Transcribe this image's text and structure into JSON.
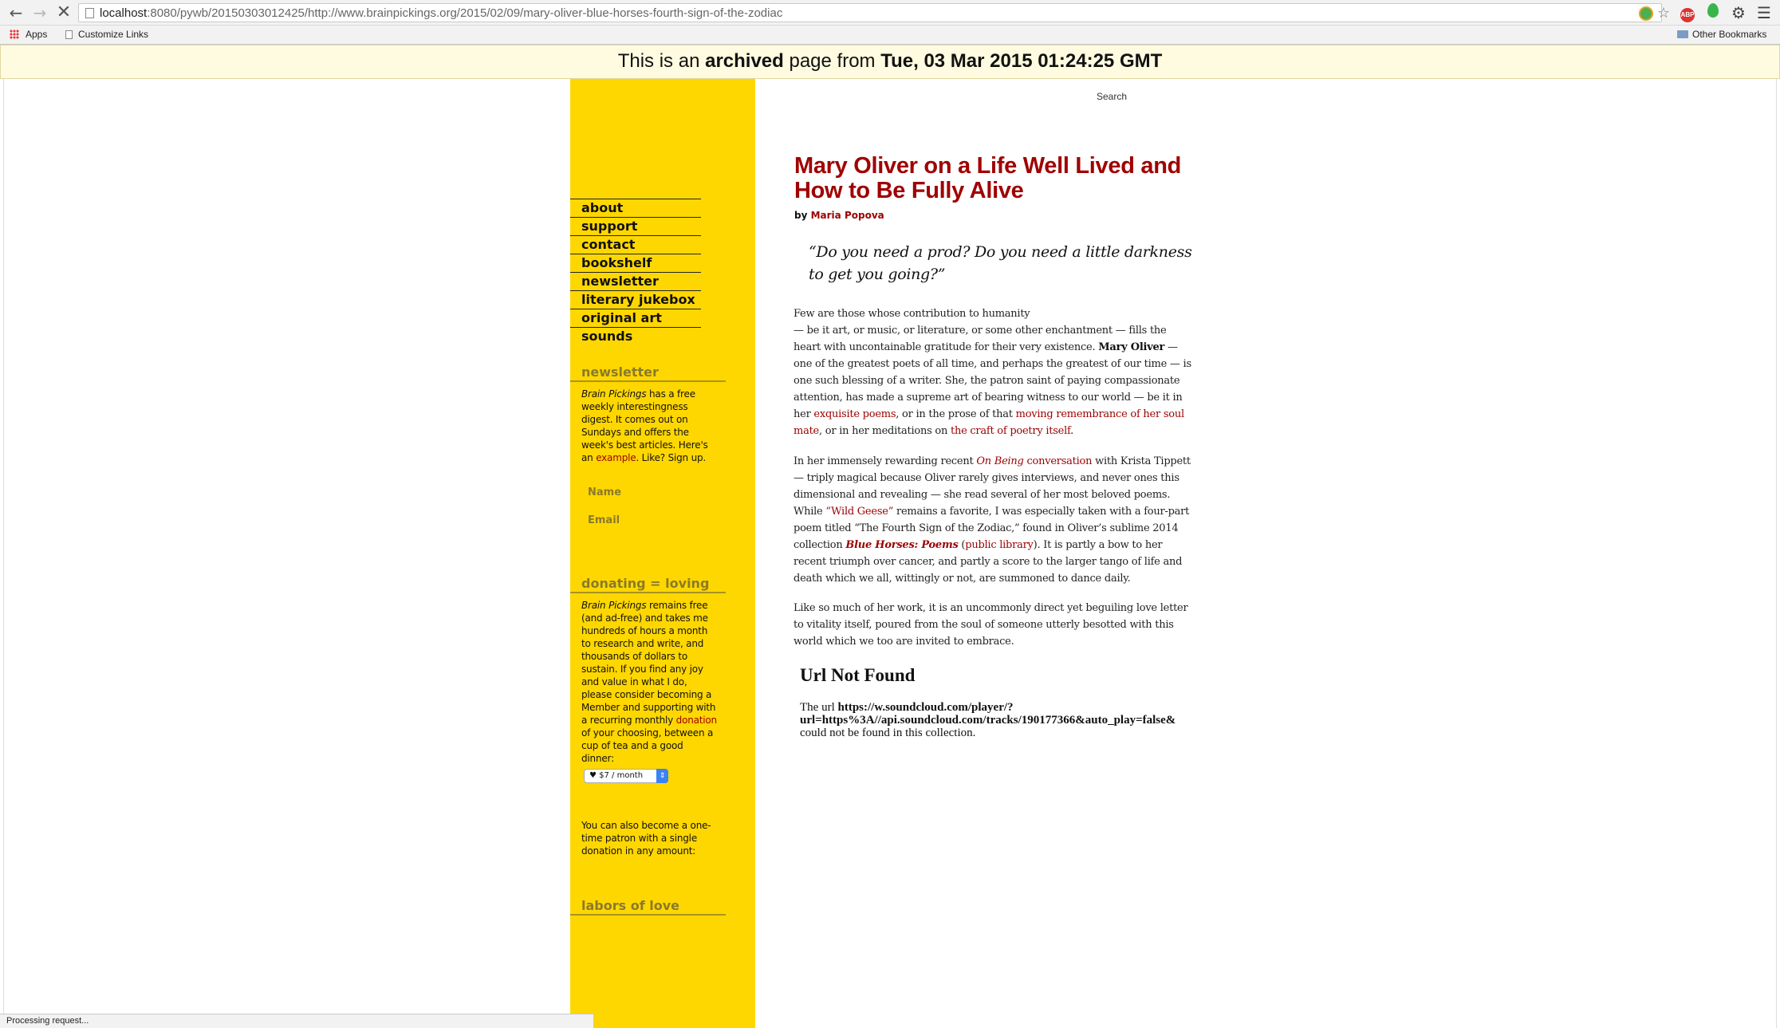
{
  "browser": {
    "url_host": "localhost",
    "url_rest": ":8080/pywb/20150303012425/http://www.brainpickings.org/2015/02/09/mary-oliver-blue-horses-fourth-sign-of-the-zodiac",
    "back_glyph": "←",
    "forward_glyph": "→",
    "stop_glyph": "✕",
    "bookmarks": {
      "apps": "Apps",
      "customize": "Customize Links",
      "other": "Other Bookmarks"
    },
    "adblock_label": "ABP",
    "status": "Processing request..."
  },
  "banner": {
    "prefix": "This is an ",
    "strong1": "archived",
    "middle": " page from ",
    "strong2": "Tue, 03 Mar 2015 01:24:25 GMT"
  },
  "sidebar": {
    "nav": [
      "about",
      "support",
      "contact",
      "bookshelf",
      "newsletter",
      "literary jukebox",
      "original art",
      "sounds"
    ],
    "newsletter": {
      "heading": "newsletter",
      "em": "Brain Pickings",
      "text1": " has a free weekly interestingness digest. It comes out on Sundays and offers the week's best articles. Here's an ",
      "link": "example",
      "text2": ". Like? Sign up.",
      "name_placeholder": "Name",
      "email_placeholder": "Email"
    },
    "donating": {
      "heading": "donating = loving",
      "em": "Brain Pickings",
      "text1": " remains free (and ad-free) and takes me hundreds of hours a month to research and write, and thousands of dollars to sustain. If you find any joy and value in what I do, please consider becoming a Member and supporting with a recurring monthly ",
      "link": "donation",
      "text2": " of your choosing, between a cup of tea and a good dinner:",
      "select_value": "♥ $7 / month",
      "one_time": "You can also become a one-time patron with a single donation in any amount:"
    },
    "labors": {
      "heading": "labors of love"
    }
  },
  "main": {
    "search_label": "Search",
    "title": "Mary Oliver on a Life Well Lived and How to Be Fully Alive",
    "byline_prefix": "by ",
    "author": "Maria Popova",
    "quote": "“Do you need a prod? Do you need a little darkness to get you going?”",
    "p1": {
      "a": "Few are those whose contribution to humanity",
      "b": "— be it art, or music, or literature, or some other enchantment — fills the heart with uncontainable gratitude for their very existence. ",
      "bold": "Mary Oliver",
      "c": " — one of the greatest poets of all time, and perhaps the greatest of our time — is one such blessing of a writer. She, the patron saint of paying compassionate attention, has made a supreme art of bearing witness to our world — be it in her ",
      "link1": "exquisite poems",
      "d": ", or in the prose of that ",
      "link2": "moving remembrance of her soul mate",
      "e": ", or in her meditations on ",
      "link3": "the craft of poetry itself",
      "f": "."
    },
    "p2": {
      "a": "In her immensely rewarding recent ",
      "link1_i": "On Being",
      "link1": " conversation",
      "b": " with Krista Tippett — triply magical because Oliver rarely gives interviews, and never ones this dimensional and revealing — she read several of her most beloved poems. While ",
      "link2": "“Wild Geese”",
      "c": " remains a favorite, I was especially taken with a four-part poem titled “The Fourth Sign of the Zodiac,” found in Oliver’s sublime 2014 collection ",
      "book": "Blue Horses: Poems",
      "d": " (",
      "link3": "public library",
      "e": "). It is partly a bow to her recent triumph over cancer, and partly a score to the larger tango of life and death which we all, wittingly or not, are summoned to dance daily."
    },
    "p3": "Like so much of her work, it is an uncommonly direct yet beguiling love letter to vitality itself, poured from the soul of someone utterly besotted with this world which we too are invited to embrace.",
    "error": {
      "heading": "Url Not Found",
      "prefix": "The url ",
      "url1": "https://w.soundcloud.com/player/?",
      "url2": "url=https%3A//api.soundcloud.com/tracks/190177366&auto_play=false&",
      "suffix": "could not be found in this collection."
    }
  },
  "colors": {
    "sidebar_bg": "#ffd700",
    "title_red": "#a00000",
    "link_red": "#9b0000",
    "banner_bg": "#fffbe0",
    "side_heading": "#8a7a2a"
  }
}
